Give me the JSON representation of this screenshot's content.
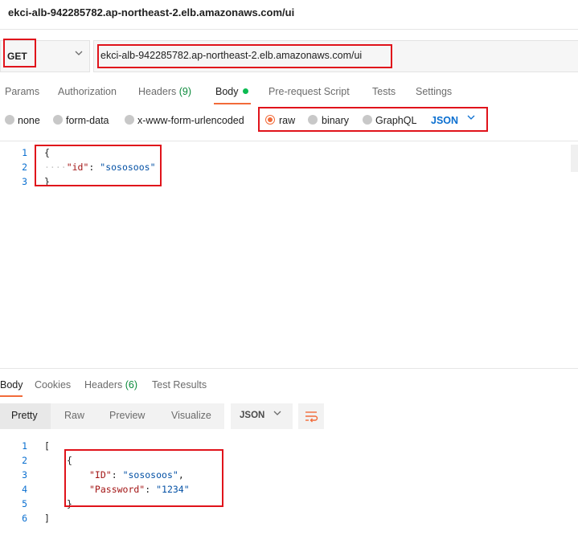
{
  "page_title": "ekci-alb-942285782.ap-northeast-2.elb.amazonaws.com/ui",
  "request": {
    "method": "GET",
    "url": "ekci-alb-942285782.ap-northeast-2.elb.amazonaws.com/ui"
  },
  "request_tabs": [
    {
      "label": "Params"
    },
    {
      "label": "Authorization"
    },
    {
      "label": "Headers",
      "badge": "(9)"
    },
    {
      "label": "Body",
      "active": true
    },
    {
      "label": "Pre-request Script"
    },
    {
      "label": "Tests"
    },
    {
      "label": "Settings"
    }
  ],
  "body_modes": [
    "none",
    "form-data",
    "x-www-form-urlencoded",
    "raw",
    "binary",
    "GraphQL"
  ],
  "selected_body_mode": "raw",
  "body_format": "JSON",
  "request_body": {
    "line_numbers": [
      "1",
      "2",
      "3"
    ],
    "open": "{",
    "key": "\"id\"",
    "colon": ": ",
    "value": "\"sososoos\"",
    "close": "}"
  },
  "response_tabs": [
    {
      "label": "Body",
      "active": true
    },
    {
      "label": "Cookies"
    },
    {
      "label": "Headers",
      "badge": "(6)"
    },
    {
      "label": "Test Results"
    }
  ],
  "view_modes": [
    "Pretty",
    "Raw",
    "Preview",
    "Visualize"
  ],
  "response_format": "JSON",
  "response_body": {
    "line_numbers": [
      "1",
      "2",
      "3",
      "4",
      "5",
      "6"
    ],
    "open_array": "[",
    "open_obj": "{",
    "key1": "\"ID\"",
    "val1": "\"sososoos\"",
    "key2": "\"Password\"",
    "val2": "\"1234\"",
    "close_obj": "}",
    "close_array": "]"
  },
  "colors": {
    "accent": "#f26b3a",
    "highlight_box": "#e0131b",
    "link_blue": "#0a6fd0",
    "badge_green": "#0b8a3b"
  }
}
